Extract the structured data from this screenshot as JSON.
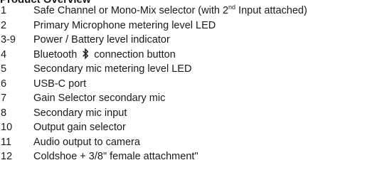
{
  "heading": "Product Overview",
  "items": [
    {
      "num": "1",
      "pre": "Safe Channel or Mono-Mix selector (with 2",
      "sup": "nd",
      "post": " Input attached)"
    },
    {
      "num": "2",
      "text": "Primary Microphone metering level LED"
    },
    {
      "num": "3-9",
      "text": "Power / Battery level indicator"
    },
    {
      "num": "4",
      "pre": "Bluetooth",
      "icon": "bluetooth-icon",
      "post": "connection button"
    },
    {
      "num": "5",
      "text": "Secondary mic metering level LED"
    },
    {
      "num": "6",
      "text": "USB-C port"
    },
    {
      "num": "7",
      "text": "Gain Selector secondary mic"
    },
    {
      "num": "8",
      "text": "Secondary mic input"
    },
    {
      "num": "10",
      "text": "Output gain selector"
    },
    {
      "num": "11",
      "text": "Audio output to camera"
    },
    {
      "num": "12",
      "text": "Coldshoe + 3/8\" female attachment\""
    }
  ]
}
